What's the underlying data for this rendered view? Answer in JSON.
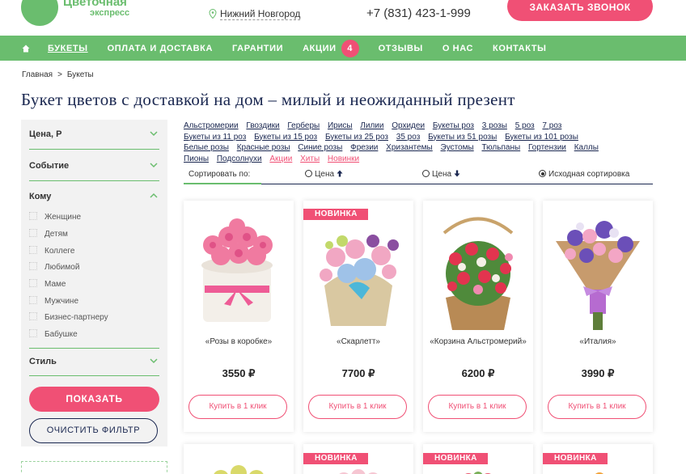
{
  "header": {
    "logo_title": "Цветочная",
    "logo_sub": "экспресс",
    "city": "Нижний Новгород",
    "phone": "+7 (831) 423-1-999",
    "callback_label": "ЗАКАЗАТЬ ЗВОНОК"
  },
  "nav": {
    "items": [
      "БУКЕТЫ",
      "ОПЛАТА И ДОСТАВКА",
      "ГАРАНТИИ",
      "АКЦИИ",
      "ОТЗЫВЫ",
      "О НАС",
      "КОНТАКТЫ"
    ],
    "promo_count": "4"
  },
  "breadcrumb": {
    "home": "Главная",
    "sep": ">",
    "current": "Букеты"
  },
  "page_title": "Букет цветов с доставкой на дом – милый и неожиданный презент",
  "filters": {
    "price": "Цена, Р",
    "event": "Событие",
    "whom": "Кому",
    "whom_options": [
      "Женщине",
      "Детям",
      "Коллеге",
      "Любимой",
      "Маме",
      "Мужчине",
      "Бизнес-партнеру",
      "Бабушке"
    ],
    "style": "Стиль",
    "show_label": "ПОКАЗАТЬ",
    "clear_label": "ОЧИСТИТЬ ФИЛЬТР"
  },
  "tags": [
    {
      "t": "Альстромерии"
    },
    {
      "t": "Гвоздики"
    },
    {
      "t": "Герберы"
    },
    {
      "t": "Ирисы"
    },
    {
      "t": "Лилии"
    },
    {
      "t": "Орхидеи"
    },
    {
      "t": "Букеты роз"
    },
    {
      "t": "3 розы"
    },
    {
      "t": "5 роз"
    },
    {
      "t": "7 роз"
    },
    {
      "t": "Букеты из 11 роз"
    },
    {
      "t": "Букеты из 15 роз"
    },
    {
      "t": "Букеты из 25 роз"
    },
    {
      "t": "35 роз"
    },
    {
      "t": "Букеты из 51 розы"
    },
    {
      "t": "Букеты из 101 розы"
    },
    {
      "t": "Белые розы"
    },
    {
      "t": "Красные розы"
    },
    {
      "t": "Синие розы"
    },
    {
      "t": "Фрезии"
    },
    {
      "t": "Хризантемы"
    },
    {
      "t": "Эустомы"
    },
    {
      "t": "Тюльпаны"
    },
    {
      "t": "Гортензии"
    },
    {
      "t": "Каллы"
    },
    {
      "t": "Пионы"
    },
    {
      "t": "Подсолнухи"
    },
    {
      "t": "Акции",
      "pink": true
    },
    {
      "t": "Хиты",
      "pink": true
    },
    {
      "t": "Новинки",
      "pink": true
    }
  ],
  "sort": {
    "label": "Сортировать по:",
    "price_asc": "Цена",
    "price_desc": "Цена",
    "default": "Исходная сортировка"
  },
  "products": [
    {
      "name": "«Розы в коробке»",
      "price": "3550 ₽",
      "buy": "Купить в 1 клик",
      "new": false
    },
    {
      "name": "«Скарлетт»",
      "price": "7700 ₽",
      "buy": "Купить в 1 клик",
      "new": true,
      "badge": "НОВИНКА"
    },
    {
      "name": "«Корзина Альстромерий»",
      "price": "6200 ₽",
      "buy": "Купить в 1 клик",
      "new": false
    },
    {
      "name": "«Италия»",
      "price": "3990 ₽",
      "buy": "Купить в 1 клик",
      "new": false
    }
  ],
  "second_row_badges": [
    "",
    "НОВИНКА",
    "НОВИНКА",
    "НОВИНКА"
  ],
  "colors": {
    "green": "#6abd6e",
    "pink": "#f05075",
    "navy": "#1a2750"
  }
}
